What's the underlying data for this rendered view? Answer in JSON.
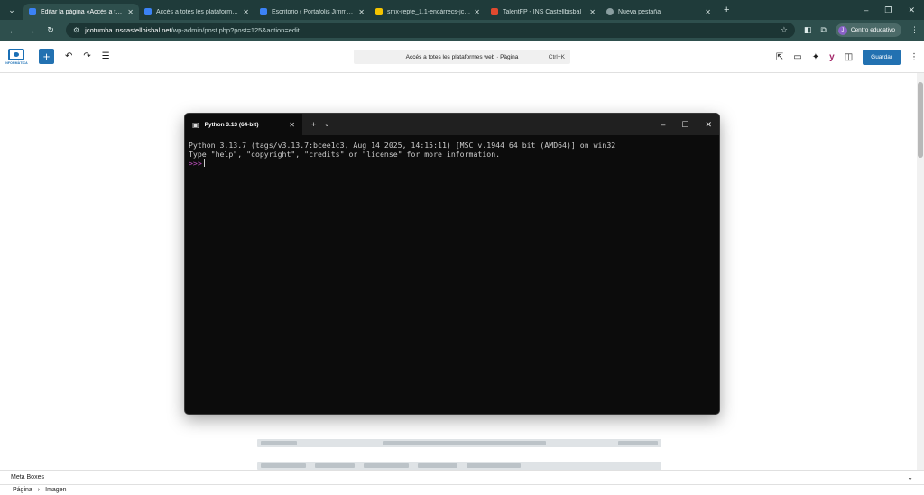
{
  "browser": {
    "tabs": [
      {
        "label": "Editar la página «Accés a totes les",
        "color": "#3b82f6",
        "active": true
      },
      {
        "label": "Accés a totes les plataformes web",
        "color": "#3b82f6",
        "active": false
      },
      {
        "label": "Escritorio ‹ Portafolis Jimmy Co",
        "color": "#3b82f6",
        "active": false
      },
      {
        "label": "smx-repte_1.1-encàrrecs-jcotu",
        "color": "#f5c400",
        "active": false
      },
      {
        "label": "TalentFP - INS Castellbisbal",
        "color": "#e04a2f",
        "active": false
      },
      {
        "label": "Nueva pestaña",
        "color": "#8a9ea0",
        "active": false
      }
    ],
    "url_host": "jcotumba.inscastellbisbal.net",
    "url_path": "/wp-admin/post.php?post=125&action=edit",
    "profile_label": "Centro educativo",
    "profile_initial": "J"
  },
  "editor": {
    "logo_label": "INFORMÀTICA",
    "command_bar_label": "Accés a totes les plataformes web · Pàgina",
    "command_bar_shortcut": "Ctrl+K",
    "save_label": "Guardar",
    "yoast_label": "y"
  },
  "terminal": {
    "tab_title": "Python 3.13 (64-bit)",
    "line1": "Python 3.13.7 (tags/v3.13.7:bcee1c3, Aug 14 2025, 14:15:11) [MSC v.1944 64 bit (AMD64)] on win32",
    "line2": "Type \"help\", \"copyright\", \"credits\" or \"license\" for more information.",
    "prompt": ">>>"
  },
  "footer": {
    "meta_boxes_label": "Meta Boxes",
    "breadcrumb_page": "Página",
    "breadcrumb_block": "Imagen"
  }
}
